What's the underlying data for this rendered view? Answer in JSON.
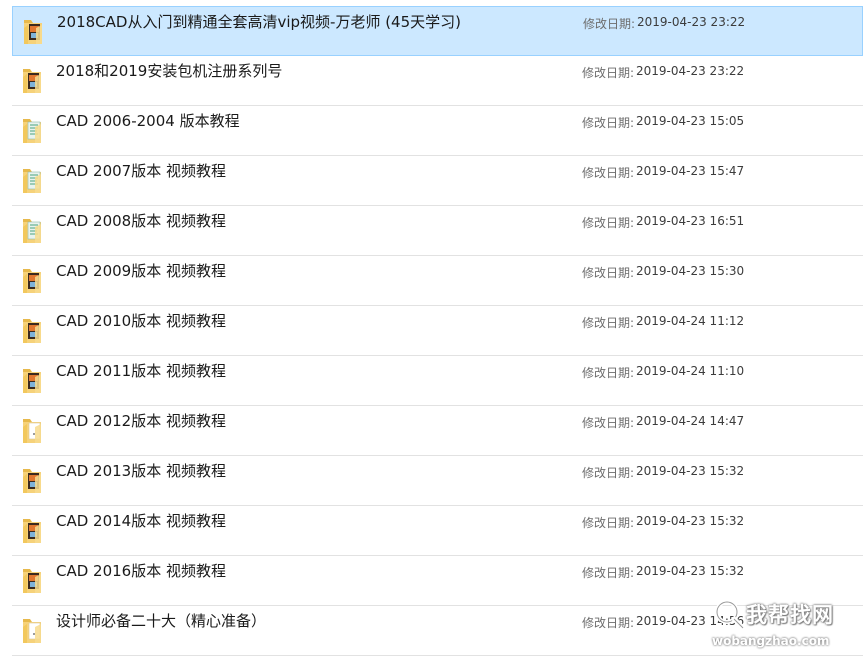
{
  "files": [
    {
      "name": "2018CAD从入门到精通全套高清vip视频-万老师  (45天学习)",
      "date_label": "修改日期:",
      "date": "2019-04-23 23:22",
      "icon": "folder-with-image-icon",
      "selected": true
    },
    {
      "name": "2018和2019安装包机注册系列号",
      "date_label": "修改日期:",
      "date": "2019-04-23 23:22",
      "icon": "folder-with-image-icon",
      "selected": false
    },
    {
      "name": "CAD 2006-2004 版本教程",
      "date_label": "修改日期:",
      "date": "2019-04-23 15:05",
      "icon": "folder-with-document-icon",
      "selected": false
    },
    {
      "name": "CAD 2007版本 视频教程",
      "date_label": "修改日期:",
      "date": "2019-04-23 15:47",
      "icon": "folder-with-document-icon",
      "selected": false
    },
    {
      "name": "CAD 2008版本  视频教程",
      "date_label": "修改日期:",
      "date": "2019-04-23 16:51",
      "icon": "folder-with-document-icon",
      "selected": false
    },
    {
      "name": "CAD 2009版本  视频教程",
      "date_label": "修改日期:",
      "date": "2019-04-23 15:30",
      "icon": "folder-with-image-icon",
      "selected": false
    },
    {
      "name": "CAD 2010版本  视频教程",
      "date_label": "修改日期:",
      "date": "2019-04-24 11:12",
      "icon": "folder-with-image-icon",
      "selected": false
    },
    {
      "name": "CAD 2011版本  视频教程",
      "date_label": "修改日期:",
      "date": "2019-04-24 11:10",
      "icon": "folder-with-image-icon",
      "selected": false
    },
    {
      "name": "CAD 2012版本  视频教程",
      "date_label": "修改日期:",
      "date": "2019-04-24 14:47",
      "icon": "folder-blank-icon",
      "selected": false
    },
    {
      "name": "CAD 2013版本  视频教程",
      "date_label": "修改日期:",
      "date": "2019-04-23 15:32",
      "icon": "folder-with-image-icon",
      "selected": false
    },
    {
      "name": "CAD 2014版本 视频教程",
      "date_label": "修改日期:",
      "date": "2019-04-23 15:32",
      "icon": "folder-with-image-icon",
      "selected": false
    },
    {
      "name": "CAD 2016版本 视频教程",
      "date_label": "修改日期:",
      "date": "2019-04-23 15:32",
      "icon": "folder-with-image-icon",
      "selected": false
    },
    {
      "name": "设计师必备二十大（精心准备）",
      "date_label": "修改日期:",
      "date": "2019-04-23 14:56",
      "icon": "folder-blank-icon",
      "selected": false
    }
  ],
  "watermark": {
    "title": "我帮找网",
    "url": "wobangzhao.com"
  },
  "colors": {
    "selection_bg": "#cce8ff",
    "selection_border": "#99d1ff",
    "folder_yellow": "#f5cf6b",
    "row_divider": "#e2e2e2"
  }
}
